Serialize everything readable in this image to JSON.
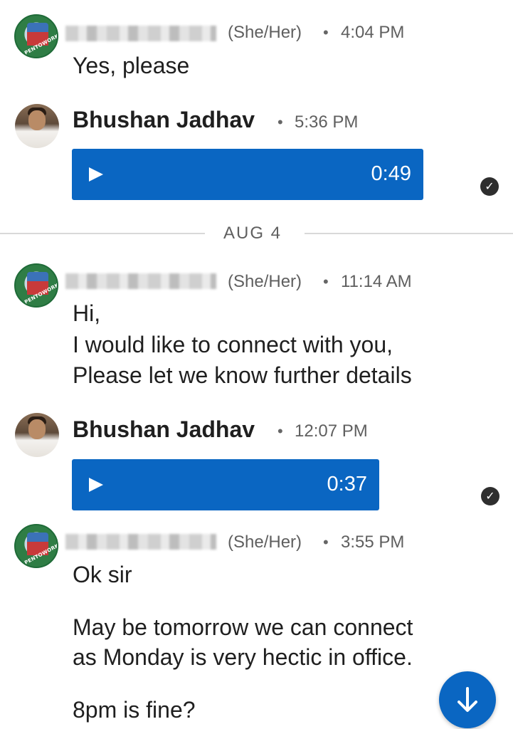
{
  "thread": {
    "messages": [
      {
        "sender": "",
        "pronouns": "(She/Her)",
        "time": "4:04 PM",
        "text": [
          "Yes, please"
        ]
      },
      {
        "sender": "Bhushan Jadhav",
        "time": "5:36 PM",
        "audio_duration": "0:49",
        "status": "delivered"
      },
      {
        "sender": "",
        "pronouns": "(She/Her)",
        "time": "11:14 AM",
        "text": [
          "Hi,",
          "I would like to connect with you,",
          "Please let we know further details"
        ]
      },
      {
        "sender": "Bhushan Jadhav",
        "time": "12:07 PM",
        "audio_duration": "0:37",
        "status": "delivered"
      },
      {
        "sender": "",
        "pronouns": "(She/Her)",
        "time": "3:55 PM",
        "text": [
          "Ok sir",
          "May be tomorrow we can connect",
          "as Monday is very hectic in office.",
          "8pm is fine?"
        ]
      }
    ],
    "date_separator": "AUG 4",
    "avatar_org_text": "OPENTOWORK",
    "separator_dot": "•"
  },
  "colors": {
    "accent": "#0a66c2",
    "text": "#1f1f1f",
    "meta": "#5f5f5f",
    "divider": "#d9d9d9"
  },
  "icons": {
    "play": "play-icon",
    "check": "check-circle-icon",
    "scroll": "arrow-down-icon"
  }
}
